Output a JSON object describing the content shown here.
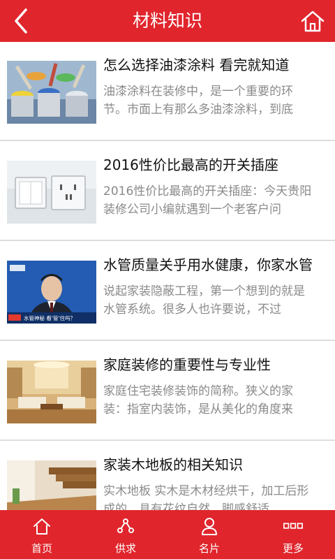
{
  "header": {
    "title": "材料知识",
    "back_icon": "back-arrow-icon",
    "home_icon": "home-icon"
  },
  "articles": [
    {
      "title": "怎么选择油漆涂料 看完就知道",
      "desc": "油漆涂料在装修中，是一个重要的环节。市面上有那么多油漆涂料，到底",
      "image": "paint-cans"
    },
    {
      "title": "2016性价比最高的开关插座",
      "desc": "2016性价比最高的开关插座：今天贵阳装修公司小编就遇到一个老客户问",
      "image": "switch-socket"
    },
    {
      "title": "水管质量关乎用水健康，你家水管",
      "desc": "说起家装隐蔽工程，第一个想到的就是水管系统。很多人也许要说，不过",
      "image": "tv-news",
      "image_caption": "水管神秘 看'管'住吗？"
    },
    {
      "title": "家庭装修的重要性与专业性",
      "desc": "家庭住宅装修装饰的简称。狭义的家装：指室内装饰，是从美化的角度来",
      "image": "living-room"
    },
    {
      "title": "家装木地板的相关知识",
      "desc": "实木地板 实木是木材经烘干，加工后形成的，具有花纹自然，脚感舒适",
      "image": "wood-floor"
    }
  ],
  "bottom_nav": [
    {
      "label": "首页",
      "icon": "home-outline-icon"
    },
    {
      "label": "供求",
      "icon": "share-nodes-icon"
    },
    {
      "label": "名片",
      "icon": "person-icon"
    },
    {
      "label": "更多",
      "icon": "more-squares-icon"
    }
  ],
  "colors": {
    "accent": "#e0252c",
    "title_text": "#111111",
    "desc_text": "#8a8a8a",
    "divider": "#dddddd"
  }
}
